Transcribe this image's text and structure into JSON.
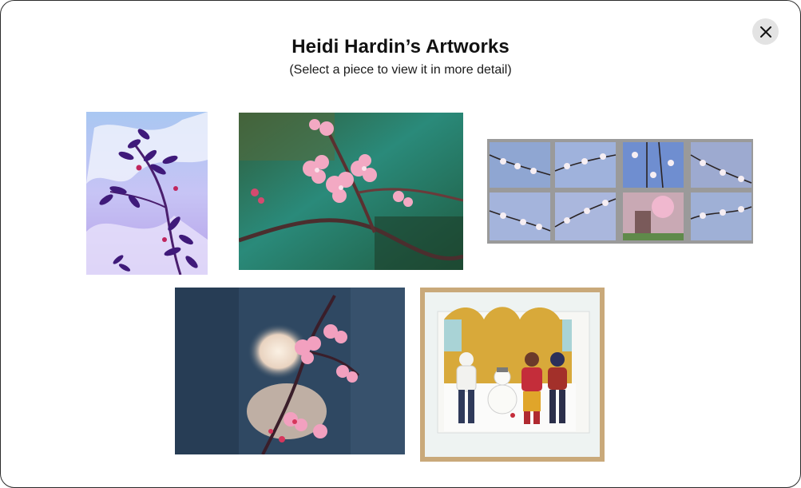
{
  "modal": {
    "title": "Heidi Hardin’s Artworks",
    "subtitle": "(Select a piece to view it in more detail)",
    "close_icon": "close-icon"
  },
  "artworks": [
    {
      "name": "artwork-purple-branch",
      "depicts": "purple and violet leafy branch against blue sky"
    },
    {
      "name": "artwork-pink-blossoms-green",
      "depicts": "pink cherry blossoms on teal green background"
    },
    {
      "name": "artwork-blossom-grid",
      "depicts": "grid of eight small cherry blossom paintings"
    },
    {
      "name": "artwork-blossoms-night",
      "depicts": "pink blossoms over dark blue background with pale glow"
    },
    {
      "name": "artwork-children-snowman",
      "depicts": "framed panel of children and snowman with gold arches"
    }
  ],
  "colors": {
    "frame_border": "#2b2b2b",
    "close_bg": "#e3e3e3",
    "text": "#111111"
  }
}
